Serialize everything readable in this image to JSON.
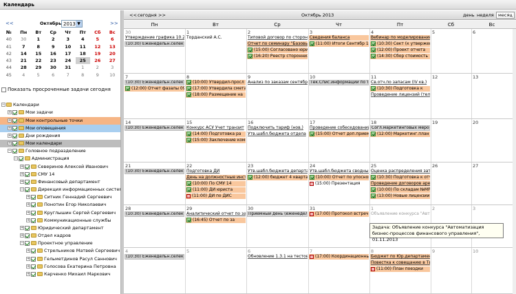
{
  "window": {
    "title": "Календарь"
  },
  "mini": {
    "prev": "<<",
    "next": ">>",
    "month": "Октябрь",
    "year": "2013",
    "headers": [
      "№",
      "Пн",
      "Вт",
      "Ср",
      "Чт",
      "Пт",
      "Сб",
      "Вс"
    ],
    "weeks": [
      {
        "w": "40",
        "d": [
          "30",
          "1",
          "2",
          "3",
          "4",
          "5",
          "6"
        ]
      },
      {
        "w": "41",
        "d": [
          "7",
          "8",
          "9",
          "10",
          "11",
          "12",
          "13"
        ]
      },
      {
        "w": "42",
        "d": [
          "14",
          "15",
          "16",
          "17",
          "18",
          "19",
          "20"
        ]
      },
      {
        "w": "43",
        "d": [
          "21",
          "22",
          "23",
          "24",
          "25",
          "26",
          "27"
        ]
      },
      {
        "w": "44",
        "d": [
          "28",
          "29",
          "30",
          "31",
          "1",
          "2",
          "3"
        ]
      },
      {
        "w": "45",
        "d": [
          "4",
          "5",
          "6",
          "7",
          "8",
          "9",
          "10"
        ]
      }
    ]
  },
  "show_overdue": "Показать просроченные задачи сегодня",
  "tree": [
    {
      "label": "Календари",
      "indent": 0
    },
    {
      "label": "Мои задачи",
      "indent": 1
    },
    {
      "label": "Мои контрольные точки",
      "indent": 1
    },
    {
      "label": "Мои оповещения",
      "indent": 1
    },
    {
      "label": "Дни рождения",
      "indent": 1
    },
    {
      "label": "Мои календари",
      "indent": 1
    },
    {
      "label": "Головное подразделение",
      "indent": 1
    },
    {
      "label": "Администрация",
      "indent": 2
    },
    {
      "label": "Северинов Алексей Иванович",
      "indent": 3
    },
    {
      "label": "СМУ 14",
      "indent": 3
    },
    {
      "label": "Финансовый департамент",
      "indent": 3
    },
    {
      "label": "Дирекция информационных систем",
      "indent": 3
    },
    {
      "label": "Ситник Геннадий Сергеевич",
      "indent": 4
    },
    {
      "label": "Понотин Егор Николаевич",
      "indent": 4
    },
    {
      "label": "Круглышин Сергей Сергеевич",
      "indent": 4
    },
    {
      "label": "Коммуникационные службы",
      "indent": 4
    },
    {
      "label": "Юридический департамент",
      "indent": 3
    },
    {
      "label": "Отдел кадров",
      "indent": 3
    },
    {
      "label": "Проектное управление",
      "indent": 3
    },
    {
      "label": "Стрельников Матвей Сергеевич",
      "indent": 4
    },
    {
      "label": "Гельметдинов Расул Саннович",
      "indent": 4
    },
    {
      "label": "Голосова Екатерина Петровна",
      "indent": 4
    },
    {
      "label": "Карченко Михаил Маркович",
      "indent": 4
    }
  ],
  "toolbar": {
    "prev": "<<",
    "today": "сегодня",
    "next": ">>",
    "title": "Октябрь 2013",
    "views": [
      "день",
      "неделя",
      "месяц"
    ]
  },
  "days": [
    "Пн",
    "Вт",
    "Ср",
    "Чт",
    "Пт",
    "Сб",
    "Вс"
  ],
  "weeks": [
    {
      "nums": [
        "30",
        "1",
        "2",
        "3",
        "4",
        "5",
        "6"
      ],
      "events": [
        {
          "d": 0,
          "r": 0,
          "t": "Утверждение графика 10.20",
          "c": "ul"
        },
        {
          "d": 0,
          "r": 1,
          "t": "(10:30) Еженедельн.селектор",
          "c": "gray"
        },
        {
          "d": 1,
          "r": 0,
          "t": "Торданский А.С.",
          "c": "white"
        },
        {
          "d": 2,
          "r": 0,
          "t": "Типовой договор по сторон",
          "c": "ul"
        },
        {
          "d": 2,
          "r": 1,
          "t": "Отчет по семинару \"Базовы",
          "c": "peach ul"
        },
        {
          "d": 2,
          "r": 2,
          "t": "(15:00) Согласовано юрист",
          "c": "peach tick"
        },
        {
          "d": 2,
          "r": 3,
          "t": "(16:20) Реестр сторонних",
          "c": "peach tick"
        },
        {
          "d": 3,
          "r": 0,
          "t": "Сведения баланса",
          "c": "peach ul"
        },
        {
          "d": 3,
          "r": 1,
          "t": "(11:00) Итоги Сентябр 13",
          "c": "peach tick"
        },
        {
          "d": 4,
          "r": 0,
          "t": "Вебинар по моделированию",
          "c": "peach ul"
        },
        {
          "d": 4,
          "r": 1,
          "t": "(10:30) Сект (к утвержен)",
          "c": "peach tick"
        },
        {
          "d": 4,
          "r": 2,
          "t": "(12:00) Проект отчета",
          "c": "peach tick"
        },
        {
          "d": 4,
          "r": 3,
          "t": "(14:30) Сбор стоимость",
          "c": "peach tick"
        }
      ]
    },
    {
      "nums": [
        "7",
        "8",
        "9",
        "10",
        "11",
        "12",
        "13"
      ],
      "events": [
        {
          "d": 0,
          "r": 0,
          "t": "(10:30) Еженедельн.селектор",
          "c": "gray"
        },
        {
          "d": 0,
          "r": 1,
          "t": "(12:00) Отчет фазалы 09.13",
          "c": "peach tick"
        },
        {
          "d": 1,
          "r": 0,
          "t": "(10:00) Утвердил-просл",
          "c": "peach tick"
        },
        {
          "d": 1,
          "r": 1,
          "t": "(17:00) Утвердила смета",
          "c": "peach tick"
        },
        {
          "d": 1,
          "r": 2,
          "t": "(18:00) Размещение на",
          "c": "peach tick"
        },
        {
          "d": 2,
          "r": 0,
          "t": "Анализ по заказам сентябрь",
          "c": "ul"
        },
        {
          "d": 3,
          "r": 0,
          "t": "Тек.Спис.информации по тем",
          "c": "gray"
        },
        {
          "d": 4,
          "r": 0,
          "t": "Св.отч.по запасам (IV кв.)",
          "c": "ul"
        },
        {
          "d": 4,
          "r": 1,
          "t": "(10:30) Подготовка к",
          "c": "peach tick"
        },
        {
          "d": 4,
          "r": 2,
          "t": "Проведение лицензий (телеф",
          "c": "ul"
        }
      ]
    },
    {
      "nums": [
        "14",
        "15",
        "16",
        "17",
        "18",
        "19",
        "20"
      ],
      "events": [
        {
          "d": 0,
          "r": 0,
          "t": "(10:30) Еженедельн.селектор",
          "c": "gray"
        },
        {
          "d": 1,
          "r": 0,
          "t": "Конкурс АСУ Учет транзит",
          "c": "ul"
        },
        {
          "d": 1,
          "r": 1,
          "t": "(14:00) Подготовка ра",
          "c": "peach tick"
        },
        {
          "d": 1,
          "r": 2,
          "t": "(15:00) Заключение комисси",
          "c": "peach tick"
        },
        {
          "d": 2,
          "r": 0,
          "t": "Подключить тариф (нов.)",
          "c": "ul"
        },
        {
          "d": 2,
          "r": 1,
          "t": "Утв.шабл.бюджета отдела",
          "c": "ul"
        },
        {
          "d": 3,
          "r": 0,
          "t": "Проведение собеседований",
          "c": "ul"
        },
        {
          "d": 3,
          "r": 1,
          "t": "(15:00) Отчет доп.приема",
          "c": "peach tick"
        },
        {
          "d": 4,
          "r": 0,
          "t": "Согл.маркетинговых мероп",
          "c": "gray"
        },
        {
          "d": 4,
          "r": 1,
          "t": "(12:00) Маркетинг.план 12.15",
          "c": "peach tick"
        }
      ]
    },
    {
      "nums": [
        "21",
        "22",
        "23",
        "24",
        "25",
        "26",
        "27"
      ],
      "events": [
        {
          "d": 0,
          "r": 0,
          "t": "(10:30) Еженедельн.селектор",
          "c": "gray"
        },
        {
          "d": 1,
          "r": 0,
          "t": "Подготовка ДИ",
          "c": "ul"
        },
        {
          "d": 1,
          "r": 1,
          "t": "День на должностные инструк",
          "c": "peach ul"
        },
        {
          "d": 1,
          "r": 2,
          "t": "(10:00) По СМУ 14",
          "c": "peach tick"
        },
        {
          "d": 1,
          "r": 3,
          "t": "(11:00) ДИ юриста",
          "c": "peach tick"
        },
        {
          "d": 1,
          "r": 4,
          "t": "(11:00) ДИ по ДИС",
          "c": "peach xbox"
        },
        {
          "d": 2,
          "r": 0,
          "t": "Утв.шабл.бюджета департам",
          "c": "ul"
        },
        {
          "d": 2,
          "r": 1,
          "t": "(12:00) бюджет 4 квартал",
          "c": "peach tick"
        },
        {
          "d": 3,
          "r": 0,
          "t": "Утв.шабл.бюджета сводный",
          "c": "ul"
        },
        {
          "d": 3,
          "r": 1,
          "t": "(10:00) Отчет по упоснов",
          "c": "peach tick"
        },
        {
          "d": 3,
          "r": 2,
          "t": "(15:00) Презентация",
          "c": "white xbox"
        },
        {
          "d": 4,
          "r": 0,
          "t": "Оценка распределения затр",
          "c": "ul"
        },
        {
          "d": 4,
          "r": 1,
          "t": "(10:30) Подготовка к отчету",
          "c": "peach tick"
        },
        {
          "d": 4,
          "r": 2,
          "t": "Проведение договоров арен",
          "c": "peach ul"
        },
        {
          "d": 4,
          "r": 3,
          "t": "(10:00) По складам №МР 35",
          "c": "peach tick"
        },
        {
          "d": 4,
          "r": 4,
          "t": "(13:00) Новые лицензии",
          "c": "peach tick"
        }
      ]
    },
    {
      "nums": [
        "28",
        "29",
        "30",
        "31",
        "1",
        "2",
        "3"
      ],
      "events": [
        {
          "d": 0,
          "r": 0,
          "t": "(10:30) Еженедельн.селектор",
          "c": "gray"
        },
        {
          "d": 1,
          "r": 0,
          "t": "Аналитический отчет по за",
          "c": "ul"
        },
        {
          "d": 1,
          "r": 1,
          "t": "(16:45) Отчет по за",
          "c": "peach tick"
        },
        {
          "d": 2,
          "r": 0,
          "t": "Приемный день (еженедельн",
          "c": "gray"
        },
        {
          "d": 3,
          "r": 0,
          "t": "(17:00) Протокол встреч",
          "c": "peach xbox"
        },
        {
          "d": 4,
          "r": 0,
          "t": "Объявление конкурса \"Авто",
          "c": "faded"
        }
      ]
    },
    {
      "nums": [
        "4",
        "5",
        "6",
        "7",
        "8",
        "9",
        "10"
      ],
      "events": [
        {
          "d": 0,
          "r": 0,
          "t": "(10:30) Еженедельн.селектор",
          "c": "gray"
        },
        {
          "d": 2,
          "r": 0,
          "t": "Обновление 1.3.1 на тестов",
          "c": "ul"
        },
        {
          "d": 3,
          "r": 0,
          "t": "(17:00) Координационный сов",
          "c": "peach xbox"
        },
        {
          "d": 4,
          "r": 0,
          "t": "Бюджет по Юр.департамен",
          "c": "peach ul"
        },
        {
          "d": 4,
          "r": 1,
          "t": "Повестка к совещанию в Твери",
          "c": "peach ul"
        },
        {
          "d": 4,
          "r": 2,
          "t": "(11:00) План поездки",
          "c": "peach xbox"
        }
      ]
    }
  ],
  "tooltip": {
    "text": "Задача: Объявление конкурса \"Автоматизация бизнес-процессов финансового управления\", 01.11.2013"
  }
}
